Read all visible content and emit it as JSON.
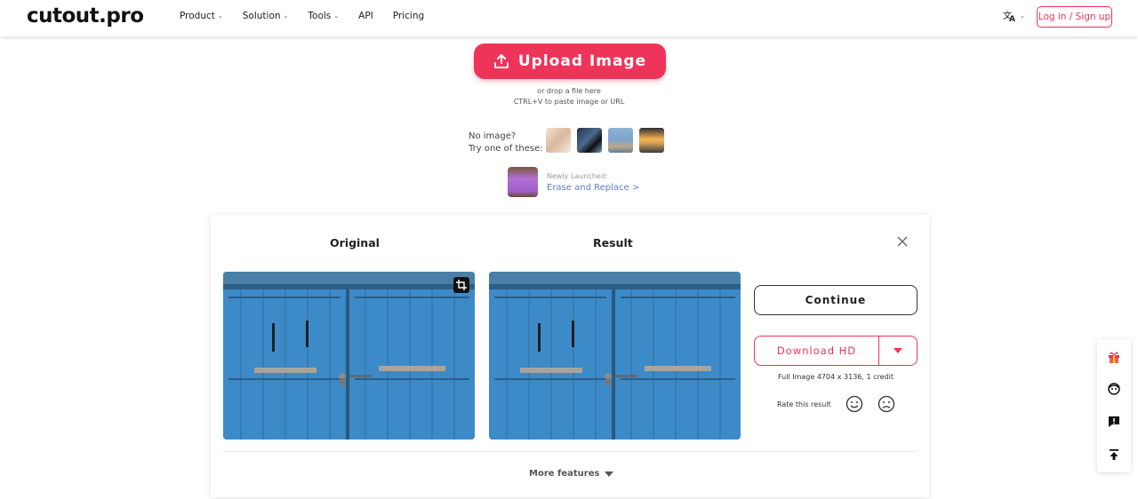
{
  "header": {
    "logo": "cutout.pro",
    "nav": [
      {
        "label": "Product",
        "has_dropdown": true
      },
      {
        "label": "Solution",
        "has_dropdown": true
      },
      {
        "label": "Tools",
        "has_dropdown": true
      },
      {
        "label": "API",
        "has_dropdown": false
      },
      {
        "label": "Pricing",
        "has_dropdown": false
      }
    ],
    "language_icon": "translate-icon",
    "login_label": "Log in / Sign up"
  },
  "upload": {
    "button_label": "Upload Image",
    "hint_line1": "or drop a file here",
    "hint_line2": "CTRL+V to paste image or URL",
    "try_line1": "No image?",
    "try_line2": "Try one of these:",
    "newly_label": "Newly Launched:",
    "newly_link": "Erase and Replace >"
  },
  "result_card": {
    "original_title": "Original",
    "result_title": "Result",
    "continue_label": "Continue",
    "download_label": "Download HD",
    "full_image_info": "Full Image 4704 x 3136, 1 credit",
    "rate_label": "Rate this result",
    "more_features": "More features"
  },
  "sidebar": {
    "icons": [
      "gift-icon",
      "support-face-icon",
      "feedback-icon",
      "back-to-top-icon"
    ]
  },
  "colors": {
    "brand": "#ee3459",
    "link": "#5c7fd0",
    "door_blue": "#3a86c4"
  }
}
